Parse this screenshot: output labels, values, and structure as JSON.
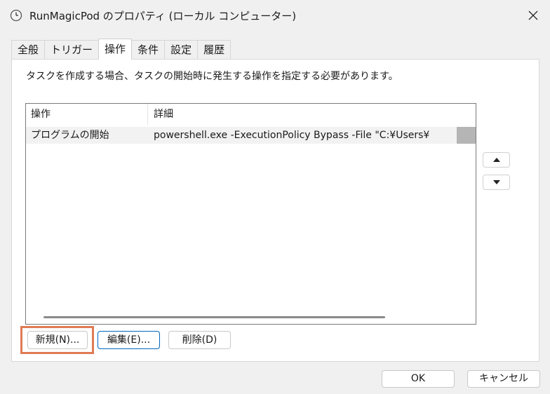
{
  "window": {
    "title": "RunMagicPod のプロパティ (ローカル コンピューター)",
    "close_icon": "close-icon",
    "title_icon": "clock-icon"
  },
  "tabs": [
    {
      "label": "全般",
      "active": false
    },
    {
      "label": "トリガー",
      "active": false
    },
    {
      "label": "操作",
      "active": true
    },
    {
      "label": "条件",
      "active": false
    },
    {
      "label": "設定",
      "active": false
    },
    {
      "label": "履歴",
      "active": false
    }
  ],
  "panel": {
    "description": "タスクを作成する場合、タスクの開始時に発生する操作を指定する必要があります。",
    "list": {
      "columns": [
        "操作",
        "詳細"
      ],
      "rows": [
        {
          "action": "プログラムの開始",
          "detail": "powershell.exe -ExecutionPolicy Bypass -File \"C:¥Users¥"
        }
      ]
    },
    "buttons": {
      "new": "新規(N)...",
      "edit": "編集(E)...",
      "delete": "削除(D)"
    },
    "move_up_icon": "triangle-up-icon",
    "move_down_icon": "triangle-down-icon"
  },
  "footer": {
    "ok": "OK",
    "cancel": "キャンセル"
  },
  "colors": {
    "highlight": "#e07b54",
    "focus": "#0067c0"
  }
}
